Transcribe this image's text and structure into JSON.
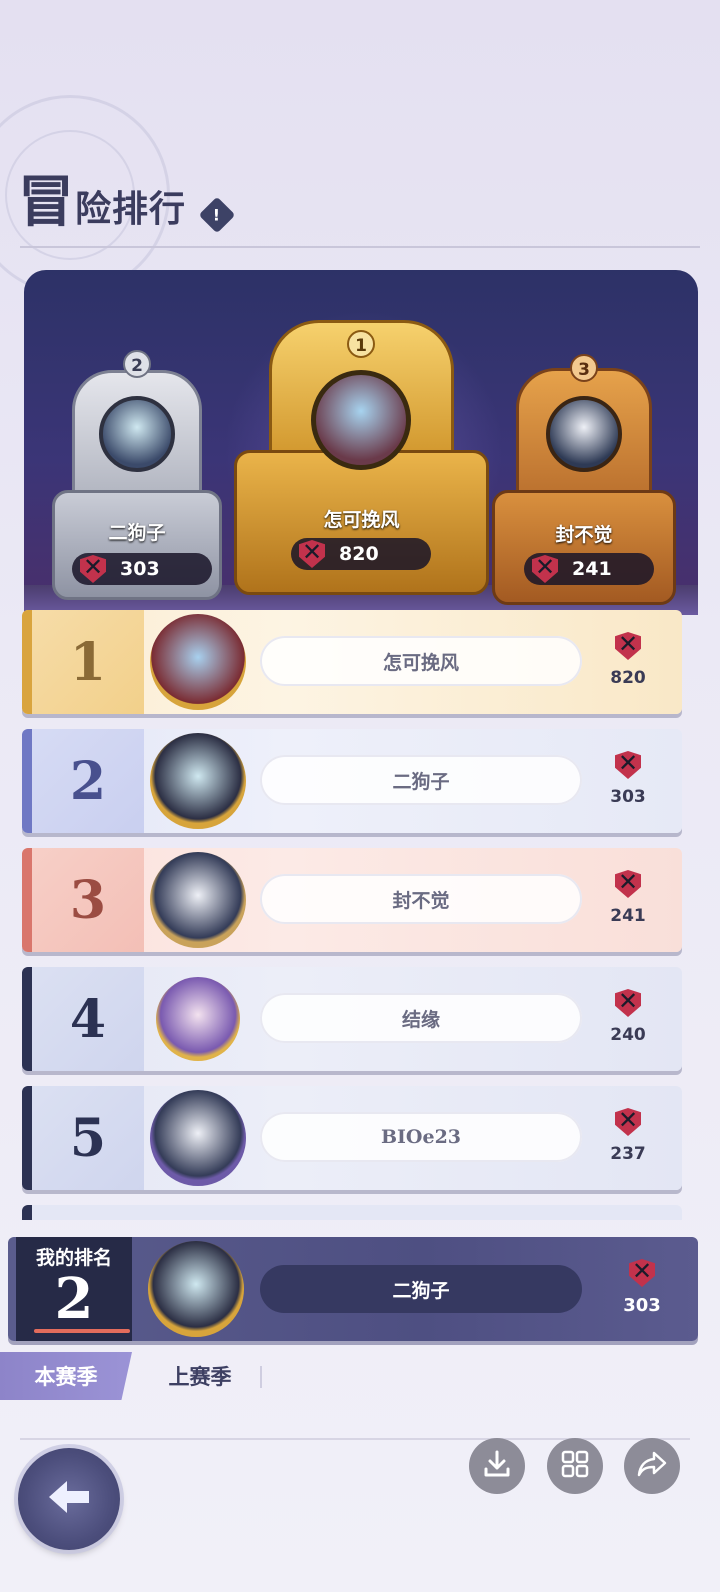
{
  "header": {
    "title_first_char": "冒",
    "title_rest": "险排行",
    "info_icon": "info-icon"
  },
  "podium": {
    "first": {
      "rank": "1",
      "name": "怎可挽风",
      "score": "820"
    },
    "second": {
      "rank": "2",
      "name": "二狗子",
      "score": "303"
    },
    "third": {
      "rank": "3",
      "name": "封不觉",
      "score": "241"
    }
  },
  "ranking": [
    {
      "rank": "1",
      "name": "怎可挽风",
      "score": "820"
    },
    {
      "rank": "2",
      "name": "二狗子",
      "score": "303"
    },
    {
      "rank": "3",
      "name": "封不觉",
      "score": "241"
    },
    {
      "rank": "4",
      "name": "结缘",
      "score": "240"
    },
    {
      "rank": "5",
      "name": "BIOe23",
      "score": "237"
    }
  ],
  "my_rank": {
    "label": "我的排名",
    "rank": "2",
    "name": "二狗子",
    "score": "303"
  },
  "tabs": {
    "current": "本赛季",
    "previous": "上赛季"
  },
  "colors": {
    "gold": "#e9b64a",
    "silver": "#6f78c4",
    "bronze": "#c96c63",
    "dark": "#2c3253",
    "accent": "#8d84c9"
  },
  "icons": {
    "back": "back-arrow-icon",
    "download": "download-icon",
    "grid": "grid-icon",
    "share": "share-icon",
    "score": "crossed-swords-crest-icon"
  }
}
